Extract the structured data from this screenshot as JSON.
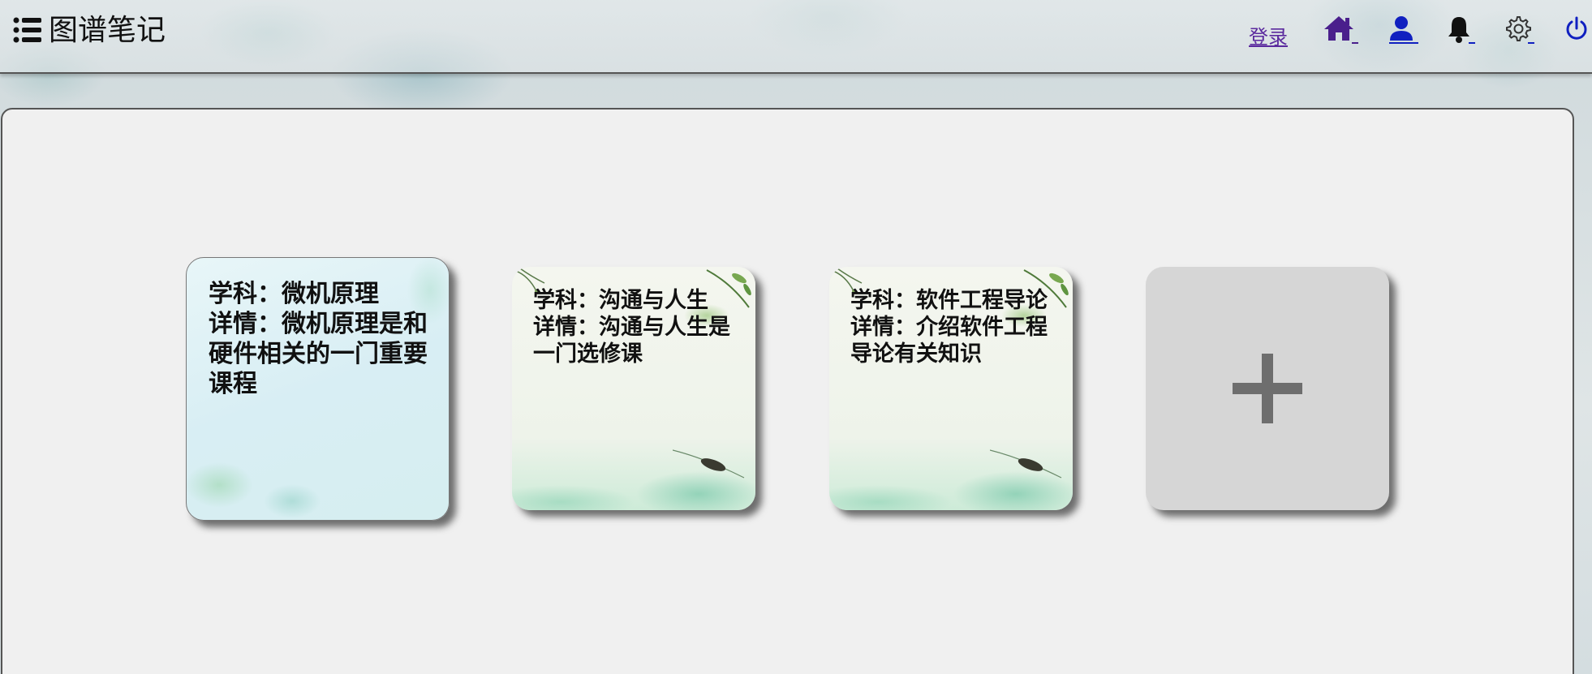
{
  "header": {
    "title": "图谱笔记",
    "login_label": "登录",
    "icons": [
      "list-icon",
      "home-icon",
      "user-icon",
      "bell-icon",
      "gear-icon",
      "power-icon"
    ],
    "colors": {
      "home": "#4a1f8c",
      "nav": "#1020c0",
      "login": "#5b2a9e"
    }
  },
  "cards": [
    {
      "text": "学科：微机原理\n详情：微机原理是和硬件相关的一门重要课程"
    },
    {
      "text": "学科：沟通与人生\n详情：沟通与人生是一门选修课"
    },
    {
      "text": "学科：软件工程导论\n详情：介绍软件工程导论有关知识"
    }
  ],
  "add_card": {
    "icon": "plus-icon"
  }
}
